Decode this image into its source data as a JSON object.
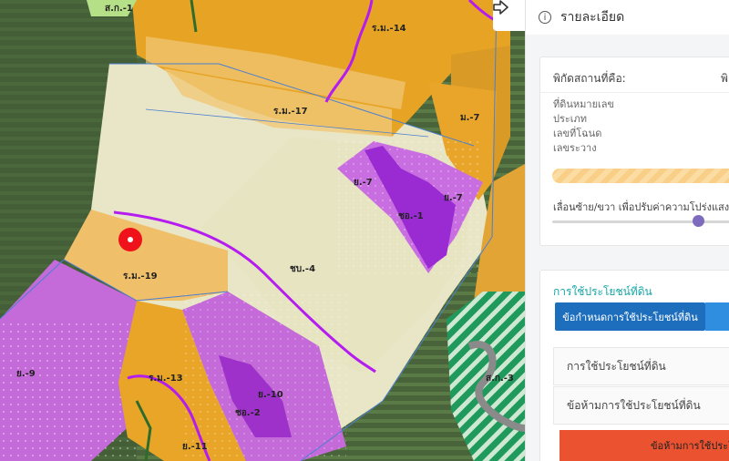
{
  "map": {
    "zones": [
      {
        "code": "ส.ก.-1"
      },
      {
        "code": "ร.ม.-14"
      },
      {
        "code": "ร.ม.-17"
      },
      {
        "code": "ม.-7"
      },
      {
        "code": "ย.-7"
      },
      {
        "code": "ย.-7 "
      },
      {
        "code": "ชอ.-1"
      },
      {
        "code": "ชบ.-4"
      },
      {
        "code": "ร.ม.-19"
      },
      {
        "code": "ย.-9"
      },
      {
        "code": "ร.ม.-13"
      },
      {
        "code": "ย.-10"
      },
      {
        "code": "ชอ.-2"
      },
      {
        "code": "ย.-11"
      },
      {
        "code": "ส.ก.-3"
      }
    ],
    "marker": {
      "color": "#f0121a"
    },
    "expand_icon": "arrow-right-icon"
  },
  "panel": {
    "header": {
      "icon": "info-icon",
      "title": "รายละเอียด"
    },
    "location": {
      "label": "พิกัดสถานที่คือ:",
      "value": "พิ",
      "fields": [
        "ที่ดินหมายเลข",
        "ประเภท",
        "เลขที่โฉนด",
        "เลขระวาง"
      ]
    },
    "opacity": {
      "label": "เลื่อนซ้าย/ขวา เพื่อปรับค่าความโปร่งแสง",
      "value": 0.73
    },
    "landuse": {
      "title": "การใช้ประโยชน์ที่ดิน",
      "tab_active": "ข้อกำหนดการใช้ประโยชน์ที่ดิน",
      "rows": [
        "การใช้ประโยชน์ที่ดิน",
        "ข้อห้ามการใช้ประโยชน์ที่ดิน"
      ],
      "button": "ข้อห้ามการใช้ประโยชน์"
    }
  },
  "colors": {
    "accent": "#16a5a5",
    "tab": "#1d6fbe",
    "button": "#ea5230",
    "slider_thumb": "#7e6bbd"
  }
}
